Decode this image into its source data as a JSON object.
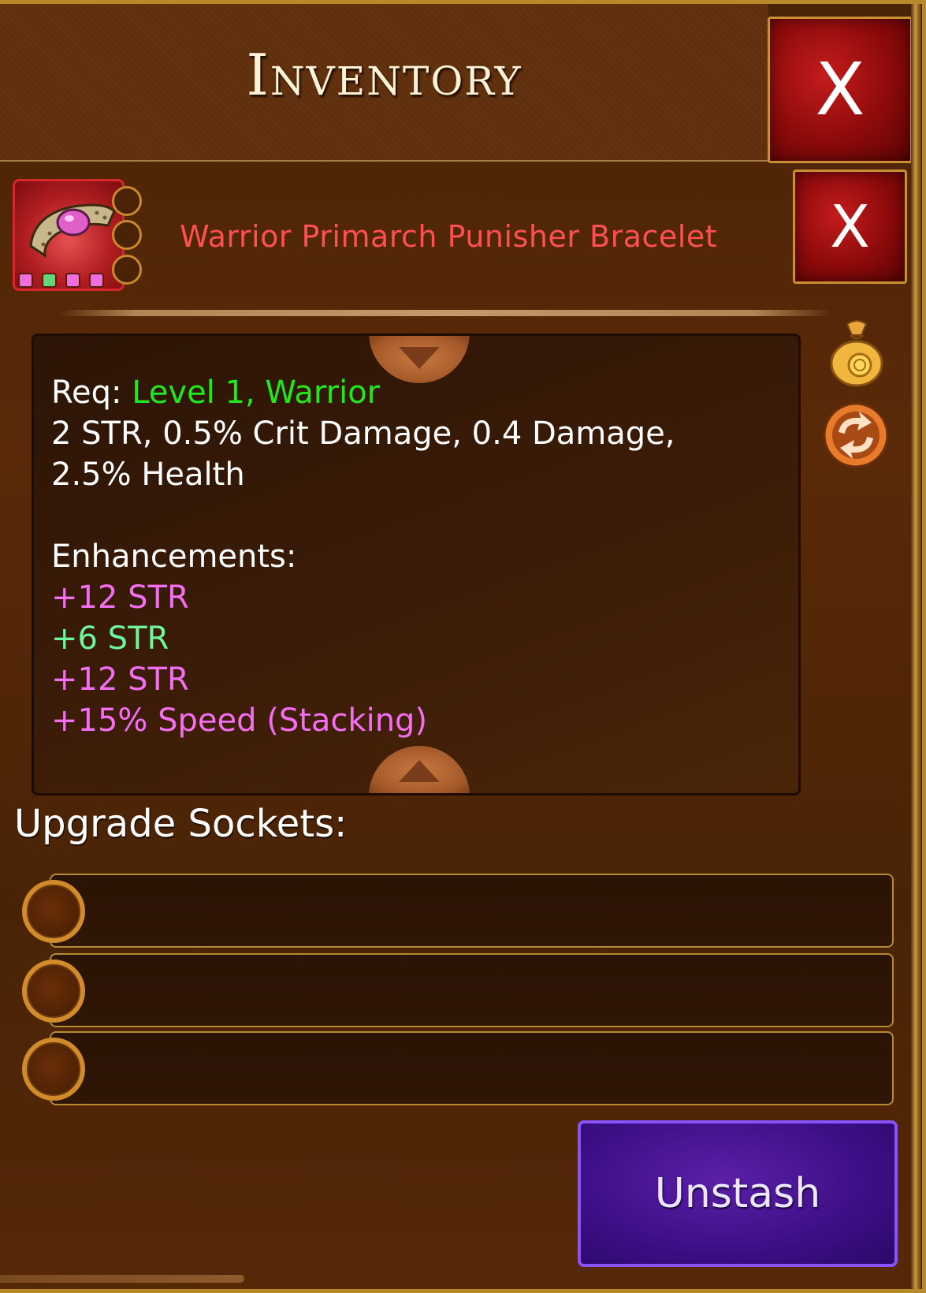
{
  "window": {
    "title": "Inventory",
    "close_label": "X"
  },
  "item": {
    "name": "Warrior Primarch Punisher Bracelet",
    "close_label": "X",
    "icon": "bracelet-icon",
    "gem_colors": [
      "#f06de0",
      "#5fd978",
      "#f06de0",
      "#f06de0"
    ]
  },
  "side_actions": {
    "sell_icon": "gold-bag-icon",
    "swap_icon": "swap-arrows-icon"
  },
  "details": {
    "req_prefix": "Req:",
    "req_values": "Level 1, Warrior",
    "stats_line1": "2 STR, 0.5% Crit Damage, 0.4 Damage,",
    "stats_line2": "2.5% Health",
    "enhancements_label": "Enhancements:",
    "enhancements": [
      {
        "text": "+12 STR",
        "color": "#f36ef0"
      },
      {
        "text": "+6 STR",
        "color": "#6ff59a"
      },
      {
        "text": "+12 STR",
        "color": "#f36ef0"
      },
      {
        "text": "+15% Speed (Stacking)",
        "color": "#f36ef0"
      }
    ]
  },
  "sockets": {
    "label": "Upgrade Sockets:",
    "slots": [
      "",
      "",
      ""
    ]
  },
  "actions": {
    "unstash_label": "Unstash"
  },
  "colors": {
    "accent_gold": "#c98f34",
    "close_red": "#8c0a0a",
    "unstash_purple": "#3c0f86",
    "item_name_red": "#ff4f4f",
    "requirement_green": "#22e81a"
  }
}
